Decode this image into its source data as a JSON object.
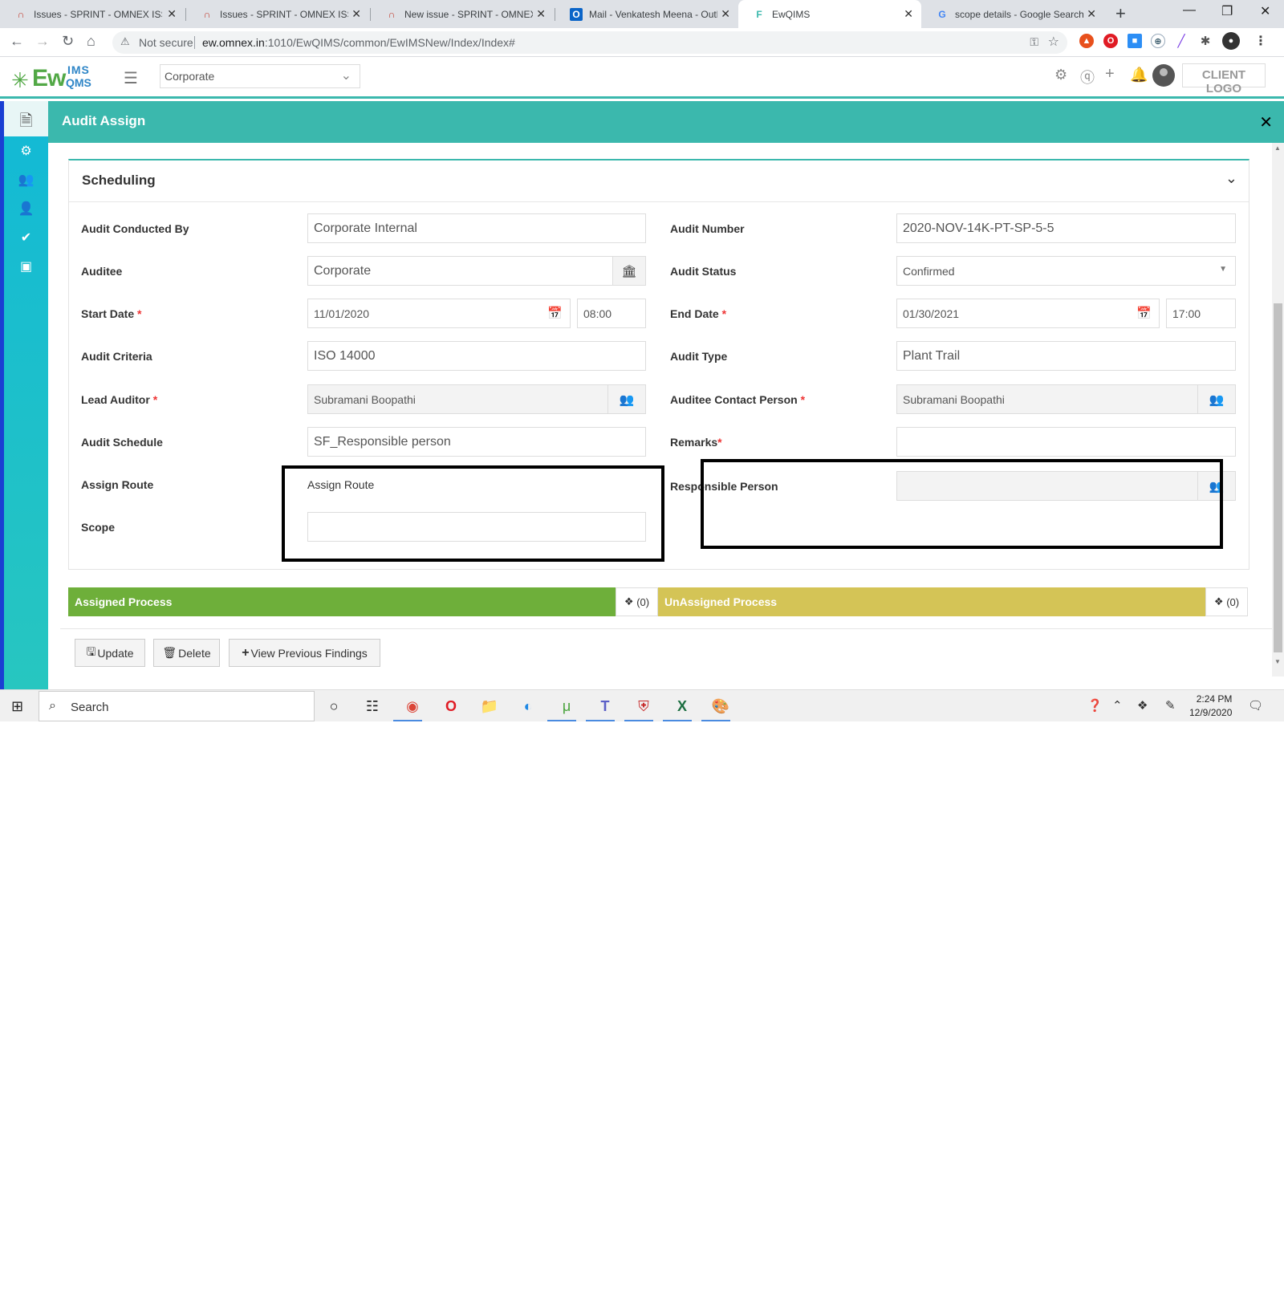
{
  "browser": {
    "tabs": [
      {
        "title": "Issues - SPRINT - OMNEX ISSUES",
        "icon": "redmine-icon"
      },
      {
        "title": "Issues - SPRINT - OMNEX ISSUES",
        "icon": "redmine-icon"
      },
      {
        "title": "New issue - SPRINT - OMNEX ISSUES",
        "icon": "redmine-icon"
      },
      {
        "title": "Mail - Venkatesh Meena - Outlook",
        "icon": "outlook-icon"
      },
      {
        "title": "EwQIMS",
        "icon": "ewqims-icon"
      },
      {
        "title": "scope details - Google Search",
        "icon": "google-icon"
      }
    ],
    "active_tab": 4,
    "security_label": "Not secure",
    "url_host": "ew.omnex.in",
    "url_path": ":1010/EwQIMS/common/EwIMSNew/Index/Index#"
  },
  "app": {
    "logo_main": "Ew",
    "logo_ims": "IMS",
    "logo_qms": "QMS",
    "org_select_value": "Corporate",
    "client_logo": "CLIENT LOGO"
  },
  "modal": {
    "title": "Audit Assign",
    "section_title": "Scheduling",
    "fields": {
      "audit_conducted_by": {
        "label": "Audit Conducted By",
        "value": "Corporate Internal"
      },
      "auditee": {
        "label": "Auditee",
        "value": "Corporate"
      },
      "start_date": {
        "label": "Start Date",
        "value": "11/01/2020",
        "time": "08:00"
      },
      "audit_criteria": {
        "label": "Audit Criteria",
        "value": "ISO 14000"
      },
      "lead_auditor": {
        "label": "Lead Auditor",
        "value": "Subramani Boopathi"
      },
      "audit_schedule": {
        "label": "Audit Schedule",
        "value": "SF_Responsible person"
      },
      "assign_route": {
        "label": "Assign Route",
        "value": "Assign Route"
      },
      "scope": {
        "label": "Scope",
        "value": ""
      },
      "audit_number": {
        "label": "Audit Number",
        "value": "2020-NOV-14K-PT-SP-5-5"
      },
      "audit_status": {
        "label": "Audit Status",
        "value": "Confirmed"
      },
      "end_date": {
        "label": "End Date",
        "value": "01/30/2021",
        "time": "17:00"
      },
      "audit_type": {
        "label": "Audit Type",
        "value": "Plant Trail"
      },
      "auditee_contact_person": {
        "label": "Auditee Contact Person",
        "value": "Subramani Boopathi"
      },
      "remarks": {
        "label": "Remarks",
        "value": ""
      },
      "responsible_person": {
        "label": "Responsible Person",
        "value": ""
      }
    },
    "required_mark": "*",
    "assigned_process": {
      "label": "Assigned Process",
      "count": "(0)",
      "color": "#6eaf3a"
    },
    "unassigned_process": {
      "label": "UnAssigned Process",
      "count": "(0)",
      "color": "#d4c456"
    },
    "buttons": {
      "update": "Update",
      "delete": "Delete",
      "view_previous": "View Previous Findings"
    }
  },
  "taskbar": {
    "search_label": "Search",
    "time": "2:24 PM",
    "date": "12/9/2020"
  },
  "colors": {
    "accent": "#3bb8ad",
    "sidebar_top": "#12b9d6",
    "sidebar_border": "#1a3fd3"
  }
}
